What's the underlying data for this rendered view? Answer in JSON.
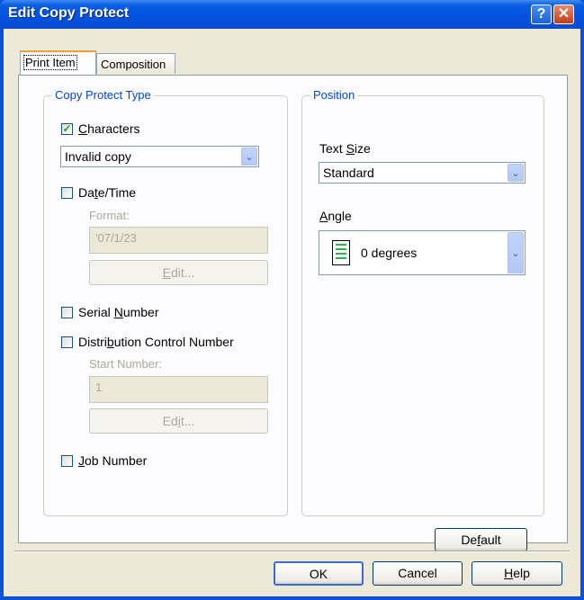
{
  "window": {
    "title": "Edit Copy Protect",
    "help_glyph": "?",
    "close_glyph": "✕"
  },
  "tabs": [
    {
      "label": "Print Item",
      "active": true
    },
    {
      "label": "Composition",
      "active": false
    }
  ],
  "copy_protect": {
    "group_title": "Copy Protect Type",
    "characters": {
      "label_pre": "",
      "label_u": "C",
      "label_post": "haracters",
      "checked": true
    },
    "characters_select": "Invalid copy",
    "datetime": {
      "label_pre": "Da",
      "label_u": "t",
      "label_post": "e/Time",
      "checked": false
    },
    "format_label": "Format:",
    "format_value": "'07/1/23",
    "edit1": {
      "pre": "",
      "u": "E",
      "post": "dit..."
    },
    "serial": {
      "label_pre": "Serial ",
      "label_u": "N",
      "label_post": "umber",
      "checked": false
    },
    "distribution": {
      "label_pre": "Distri",
      "label_u": "b",
      "label_post": "ution Control Number",
      "checked": false
    },
    "start_label": "Start Number:",
    "start_value": "1",
    "edit2": {
      "pre": "Ed",
      "u": "i",
      "post": "t..."
    },
    "job": {
      "label_pre": "",
      "label_u": "J",
      "label_post": "ob Number",
      "checked": false
    }
  },
  "position": {
    "group_title": "Position",
    "text_size_label": {
      "pre": "Text ",
      "u": "S",
      "post": "ize"
    },
    "text_size_value": "Standard",
    "angle_label": {
      "pre": "",
      "u": "A",
      "post": "ngle"
    },
    "angle_value": "0 degrees"
  },
  "buttons": {
    "default": {
      "pre": "De",
      "u": "f",
      "post": "ault"
    },
    "ok": "OK",
    "cancel": "Cancel",
    "help": {
      "pre": "",
      "u": "H",
      "post": "elp"
    }
  },
  "check_glyph": "✓",
  "dropdown_glyph": "⌄"
}
